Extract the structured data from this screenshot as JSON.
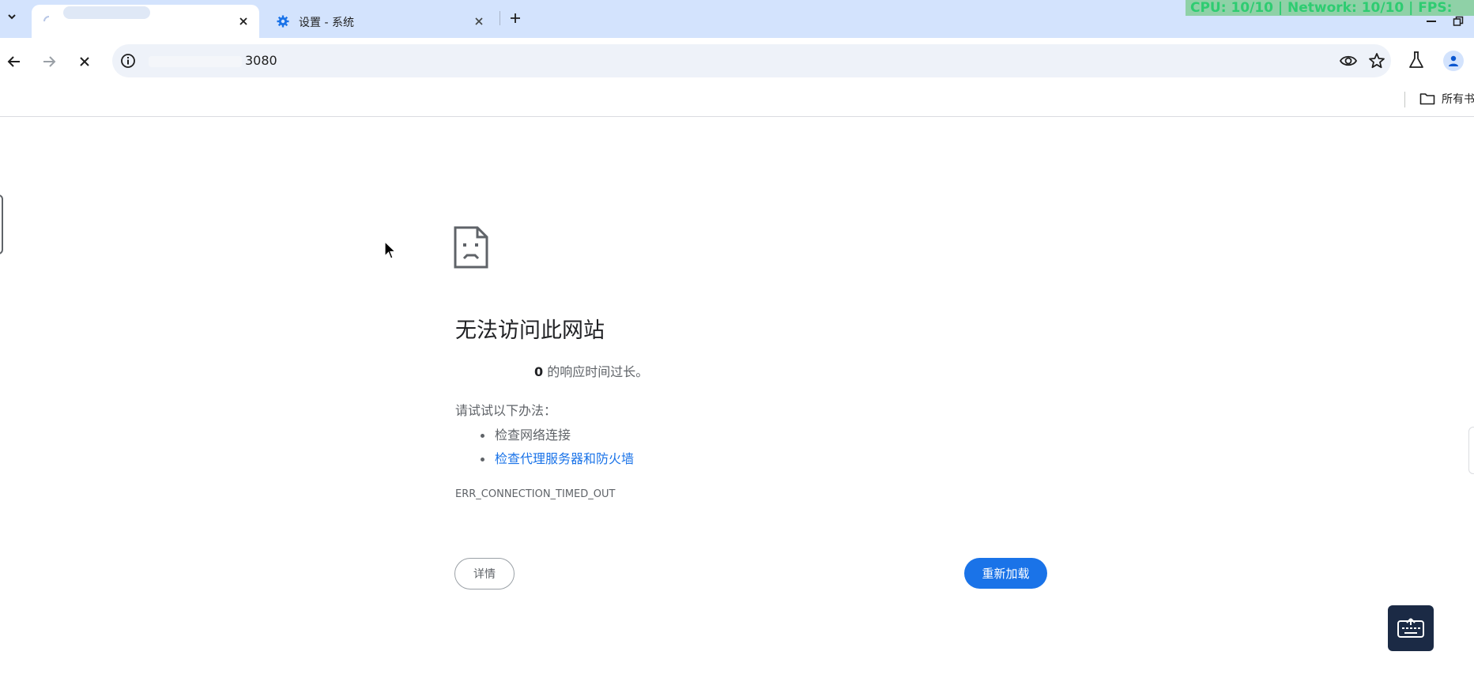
{
  "tabs": [
    {
      "title": "",
      "state": "loading",
      "active": true
    },
    {
      "title": "设置 - 系统",
      "icon": "gear-icon",
      "active": false
    }
  ],
  "perf_overlay": "CPU: 10/10 | Network: 10/10 | FPS: ",
  "address_bar": {
    "url_visible": "3080"
  },
  "bookmarks_bar": {
    "all_bookmarks_label": "所有书签"
  },
  "error_page": {
    "title": "无法访问此网站",
    "desc_host_suffix": "0",
    "desc_rest": " 的响应时间过长。",
    "try_label": "请试试以下办法：",
    "suggestions": [
      {
        "text": "检查网络连接",
        "link": false
      },
      {
        "text": "检查代理服务器和防火墙",
        "link": true
      }
    ],
    "error_code": "ERR_CONNECTION_TIMED_OUT",
    "details_button": "详情",
    "reload_button": "重新加载"
  },
  "colors": {
    "tabstrip_bg": "#d3e3fd",
    "accent_blue": "#1a73e8",
    "link_blue": "#1a73e8",
    "overlay_green": "#2ecc71",
    "keyboard_button_bg": "#1b2a45"
  }
}
